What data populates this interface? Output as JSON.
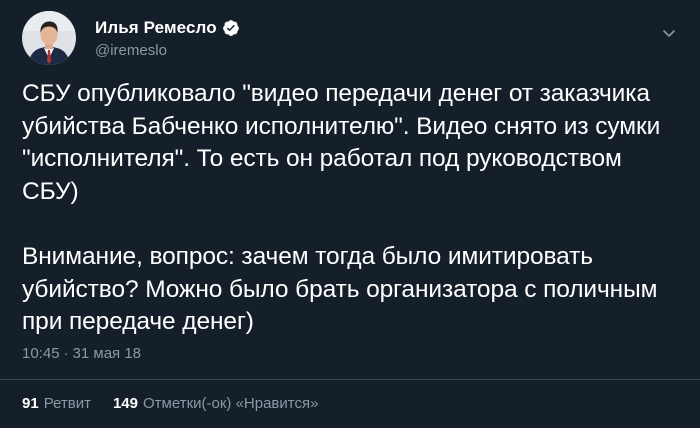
{
  "author": {
    "display_name": "Илья Ремесло",
    "handle": "@iremeslo",
    "verified": true
  },
  "icons": {
    "verified": "verified-badge-icon",
    "menu": "chevron-down-icon"
  },
  "tweet": {
    "paragraph_1": "СБУ опубликовало \"видео передачи денег от заказчика убийства Бабченко исполнителю\". Видео снято из сумки \"исполнителя\". То есть он работал под руководством СБУ)",
    "paragraph_2": "Внимание, вопрос: зачем тогда было имитировать убийство? Можно было брать организатора с поличным при передаче денег)",
    "time": "10:45",
    "separator": "·",
    "date": "31 мая 18"
  },
  "stats": {
    "retweets_count": "91",
    "retweets_label": "Ретвит",
    "likes_count": "149",
    "likes_label": "Отметки(-ок) «Нравится»"
  },
  "colors": {
    "background": "#151f2a",
    "text": "#ffffff",
    "secondary": "#8899a6",
    "divider": "#38444d",
    "verified_badge": "#ffffff"
  }
}
